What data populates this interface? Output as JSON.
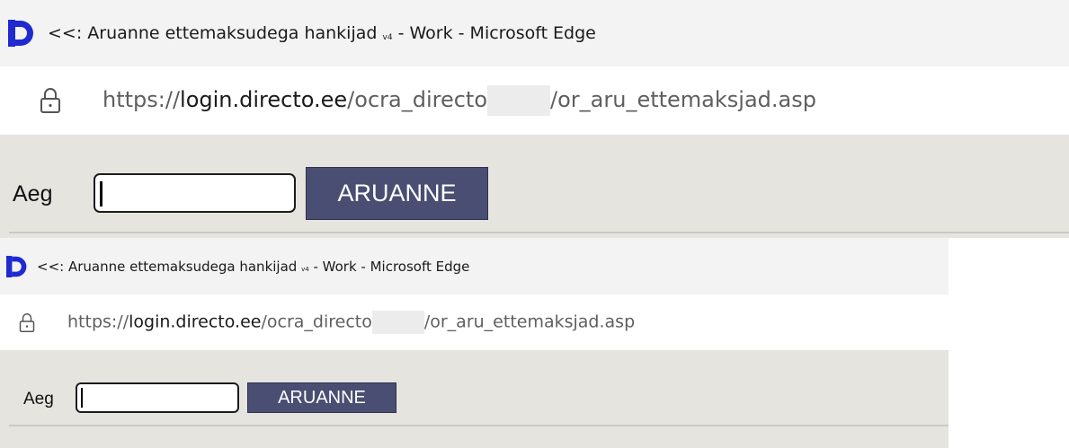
{
  "window": {
    "title_prefix": "<<: Aruanne ettemaksudega hankijad",
    "title_version": "v4",
    "title_suffix": "- Work - Microsoft Edge",
    "logo_icon": "directo-logo-icon"
  },
  "addressbar": {
    "lock_icon": "lock-icon",
    "url_scheme": "https://",
    "url_host": "login.directo.ee",
    "url_path_start": "/ocra_directo",
    "url_path_end": "/or_aru_ettemaksjad.asp"
  },
  "form": {
    "aeg_label": "Aeg",
    "aeg_value": "",
    "report_button_label": "ARUANNE"
  },
  "colors": {
    "logo": "#1f2ad1",
    "button_bg": "#4a4e72",
    "content_bg": "#e5e4df"
  }
}
